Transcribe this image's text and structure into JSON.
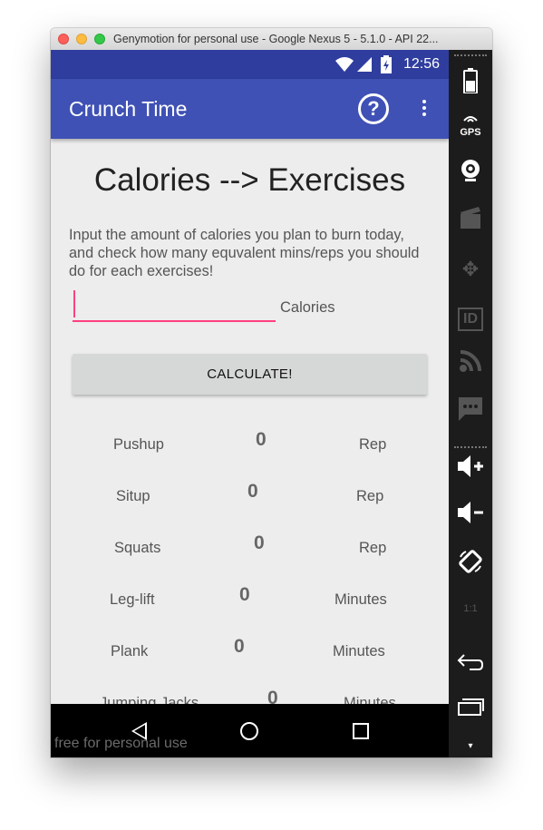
{
  "window": {
    "title": "Genymotion for personal use - Google Nexus 5 - 5.1.0 - API 22..."
  },
  "status_bar": {
    "time": "12:56"
  },
  "app_bar": {
    "title": "Crunch Time"
  },
  "page": {
    "heading": "Calories --> Exercises",
    "description": "Input the amount of calories you plan to burn today, and check how many equvalent mins/reps you should do for each exercises!",
    "calories_input": {
      "value": "",
      "placeholder": ""
    },
    "calories_label": "Calories",
    "calculate_label": "CALCULATE!"
  },
  "exercises": [
    {
      "name": "Pushup",
      "value": "0",
      "unit": "Rep"
    },
    {
      "name": "Situp",
      "value": "0",
      "unit": "Rep"
    },
    {
      "name": "Squats",
      "value": "0",
      "unit": "Rep"
    },
    {
      "name": "Leg-lift",
      "value": "0",
      "unit": "Minutes"
    },
    {
      "name": "Plank",
      "value": "0",
      "unit": "Minutes"
    },
    {
      "name": "Jumping Jacks",
      "value": "0",
      "unit": "Minutes"
    }
  ],
  "watermark": "free for personal use",
  "sidebar": {
    "gps_label": "GPS",
    "id_label": "ID"
  },
  "colors": {
    "primary": "#3f51b5",
    "primary_dark": "#2f3e9e",
    "accent": "#ff4081"
  }
}
